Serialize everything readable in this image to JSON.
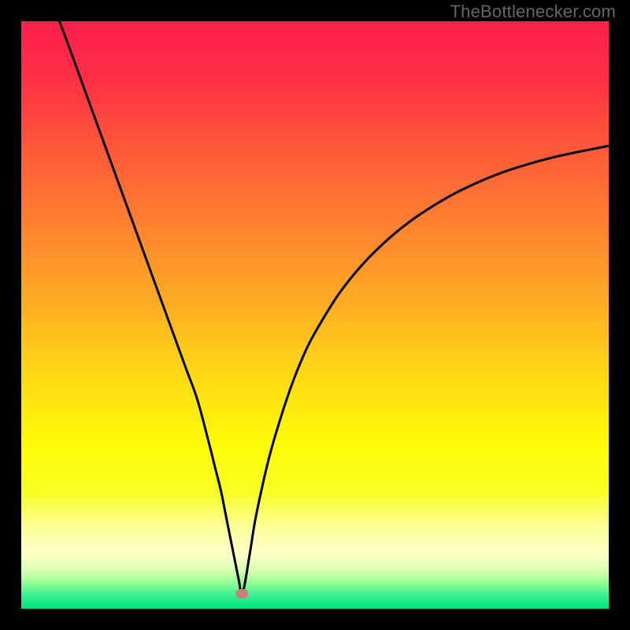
{
  "attribution": "TheBottlenecker.com",
  "chart_data": {
    "type": "line",
    "title": "",
    "xlabel": "",
    "ylabel": "",
    "xlim": [
      0,
      100
    ],
    "ylim": [
      0,
      100
    ],
    "gradient_stops": [
      {
        "pos": 0.0,
        "color": "#ff1f4b"
      },
      {
        "pos": 0.1,
        "color": "#ff3046"
      },
      {
        "pos": 0.22,
        "color": "#ff5a3a"
      },
      {
        "pos": 0.35,
        "color": "#ff8230"
      },
      {
        "pos": 0.48,
        "color": "#ffad24"
      },
      {
        "pos": 0.6,
        "color": "#ffd816"
      },
      {
        "pos": 0.72,
        "color": "#fffb08"
      },
      {
        "pos": 0.8,
        "color": "#f7ff20"
      },
      {
        "pos": 0.86,
        "color": "#ffff99"
      },
      {
        "pos": 0.905,
        "color": "#ffffc8"
      },
      {
        "pos": 0.935,
        "color": "#d8ffb0"
      },
      {
        "pos": 0.955,
        "color": "#97ff97"
      },
      {
        "pos": 0.975,
        "color": "#40f090"
      },
      {
        "pos": 1.0,
        "color": "#00e080"
      }
    ],
    "series": [
      {
        "name": "bottleneck-curve",
        "color": "#000000",
        "x": [
          6.5,
          8,
          10,
          12,
          14,
          16,
          18,
          20,
          22,
          24,
          26,
          28,
          30,
          32,
          33,
          34,
          35,
          36,
          37,
          37.5,
          38,
          39,
          40,
          42,
          44,
          46,
          48,
          50,
          54,
          58,
          62,
          66,
          70,
          74,
          78,
          82,
          86,
          90,
          94,
          98,
          100
        ],
        "y": [
          100,
          96,
          90.5,
          85,
          79.5,
          74,
          68.5,
          63,
          57.5,
          52,
          46.5,
          41,
          35.5,
          28,
          24,
          20,
          15,
          10,
          5,
          2.5,
          4,
          10,
          16,
          25,
          32,
          38,
          43,
          47,
          53.5,
          58.5,
          62.5,
          65.8,
          68.5,
          70.8,
          72.7,
          74.3,
          75.6,
          76.7,
          77.6,
          78.4,
          78.8
        ]
      }
    ],
    "marker": {
      "x": 37.5,
      "y": 2.5,
      "color": "#cc7f7d"
    }
  }
}
